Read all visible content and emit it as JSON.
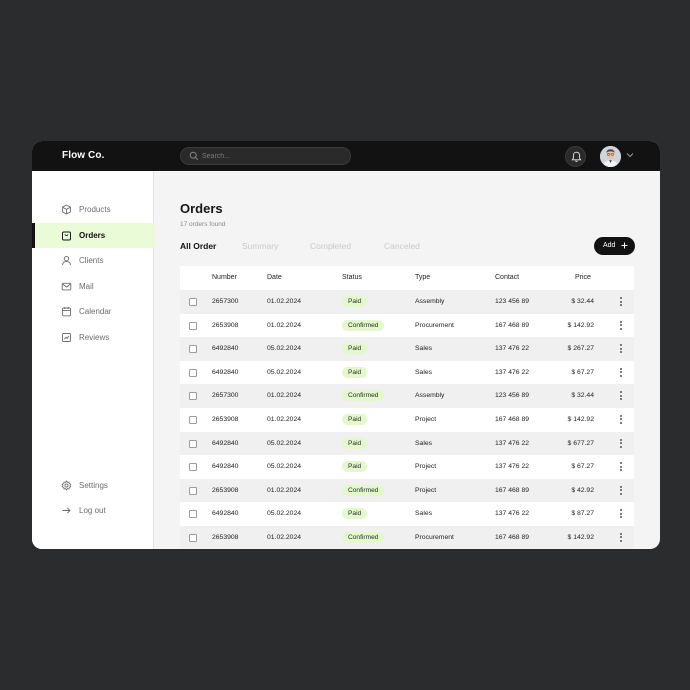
{
  "brand": "Flow Co.",
  "search": {
    "placeholder": "Search..."
  },
  "sidebar": {
    "items": [
      {
        "label": "Products",
        "icon": "cube-icon"
      },
      {
        "label": "Orders",
        "icon": "bag-icon",
        "active": true
      },
      {
        "label": "Clients",
        "icon": "user-icon"
      },
      {
        "label": "Mail",
        "icon": "mail-icon"
      },
      {
        "label": "Calendar",
        "icon": "calendar-icon"
      },
      {
        "label": "Reviews",
        "icon": "reviews-icon"
      }
    ],
    "bottom": [
      {
        "label": "Settings",
        "icon": "gear-icon"
      },
      {
        "label": "Log out",
        "icon": "logout-icon"
      }
    ]
  },
  "page": {
    "title": "Orders",
    "subtitle": "17 orders found",
    "tabs": [
      "All Order",
      "Summary",
      "Completed",
      "Canceled"
    ],
    "add_label": "Add"
  },
  "table": {
    "columns": [
      "Number",
      "Date",
      "Status",
      "Type",
      "Contact",
      "Price"
    ],
    "rows": [
      {
        "number": "2657300",
        "date": "01.02.2024",
        "status": "Paid",
        "type": "Assembly",
        "contact": "123 456 89",
        "price": "$ 32.44"
      },
      {
        "number": "2653908",
        "date": "01.02.2024",
        "status": "Confirmed",
        "type": "Procurement",
        "contact": "167 468 89",
        "price": "$ 142.92"
      },
      {
        "number": "6492840",
        "date": "05.02.2024",
        "status": "Paid",
        "type": "Sales",
        "contact": "137 476 22",
        "price": "$ 267.27"
      },
      {
        "number": "6492840",
        "date": "05.02.2024",
        "status": "Paid",
        "type": "Sales",
        "contact": "137 476 22",
        "price": "$ 67.27"
      },
      {
        "number": "2657300",
        "date": "01.02.2024",
        "status": "Confirmed",
        "type": "Assembly",
        "contact": "123 456 89",
        "price": "$ 32.44"
      },
      {
        "number": "2653908",
        "date": "01.02.2024",
        "status": "Paid",
        "type": "Project",
        "contact": "167 468 89",
        "price": "$ 142.92"
      },
      {
        "number": "6492840",
        "date": "05.02.2024",
        "status": "Paid",
        "type": "Sales",
        "contact": "137 476 22",
        "price": "$ 677.27"
      },
      {
        "number": "6492840",
        "date": "05.02.2024",
        "status": "Paid",
        "type": "Project",
        "contact": "137 476 22",
        "price": "$ 67.27"
      },
      {
        "number": "2653908",
        "date": "01.02.2024",
        "status": "Confirmed",
        "type": "Project",
        "contact": "167 468 89",
        "price": "$ 42.92"
      },
      {
        "number": "6492840",
        "date": "05.02.2024",
        "status": "Paid",
        "type": "Sales",
        "contact": "137 476 22",
        "price": "$ 87.27"
      },
      {
        "number": "2653908",
        "date": "01.02.2024",
        "status": "Confirmed",
        "type": "Procurement",
        "contact": "167 468 89",
        "price": "$ 142.92"
      }
    ]
  },
  "colors": {
    "background": "#2b2c2e",
    "topbar": "#121212",
    "accent_bg": "#eafbd7",
    "badge_bg": "#e3f9cb"
  }
}
